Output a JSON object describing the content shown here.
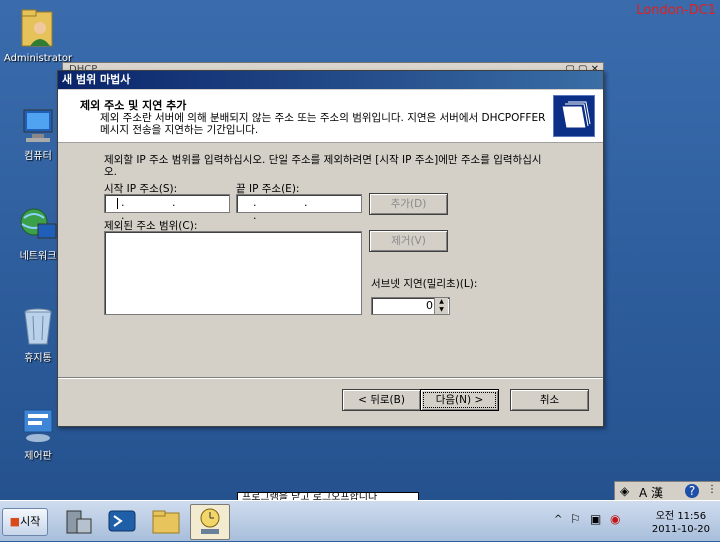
{
  "desktop": {
    "hostname": "London-DC1",
    "icons": [
      {
        "label": "Administrator",
        "icon": "user-folder-icon"
      },
      {
        "label": "컴퓨터",
        "icon": "computer-icon"
      },
      {
        "label": "네트워크",
        "icon": "network-icon"
      },
      {
        "label": "휴지통",
        "icon": "recycle-bin-icon"
      },
      {
        "label": "제어판",
        "icon": "control-panel-icon"
      }
    ]
  },
  "background_window": {
    "title": "DHCP"
  },
  "wizard": {
    "title": "새 범위 마법사",
    "header_title": "제외 주소 및 지연 추가",
    "header_desc": "제외 주소란 서버에 의해 분배되지 않는 주소 또는 주소의 범위입니다. 지연은 서버에서 DHCPOFFER 메시지 전송을 지연하는 기간입니다.",
    "instruction": "제외할 IP 주소 범위를 입력하십시오. 단일 주소를 제외하려면 [시작 IP 주소]에만 주소를 입력하십시오.",
    "start_ip_label": "시작 IP 주소(S):",
    "end_ip_label": "끝 IP 주소(E):",
    "start_ip_value": ". . .",
    "end_ip_value": ". . .",
    "add_button": "추가(D)",
    "excluded_label": "제외된 주소 범위(C):",
    "remove_button": "제거(V)",
    "subnet_delay_label": "서브넷 지연(밀리초)(L):",
    "subnet_delay_value": "0",
    "back_button": "< 뒤로(B)",
    "next_button": "다음(N) >",
    "cancel_button": "취소"
  },
  "status_tip": "프로그램을 닫고 로그오프합니다",
  "langbar": {
    "ime_label": "A 漢",
    "help": "?"
  },
  "taskbar": {
    "start_label": "시작",
    "buttons": [
      {
        "icon": "server-manager-icon",
        "active": false
      },
      {
        "icon": "powershell-icon",
        "active": false
      },
      {
        "icon": "explorer-icon",
        "active": false
      },
      {
        "icon": "dhcp-icon",
        "active": true
      }
    ],
    "clock_time": "오전 11:56",
    "clock_date": "2011-10-20"
  },
  "colors": {
    "desktop": "#2f5f9e",
    "titlebar_start": "#0a246a",
    "hostname": "#e02020"
  }
}
